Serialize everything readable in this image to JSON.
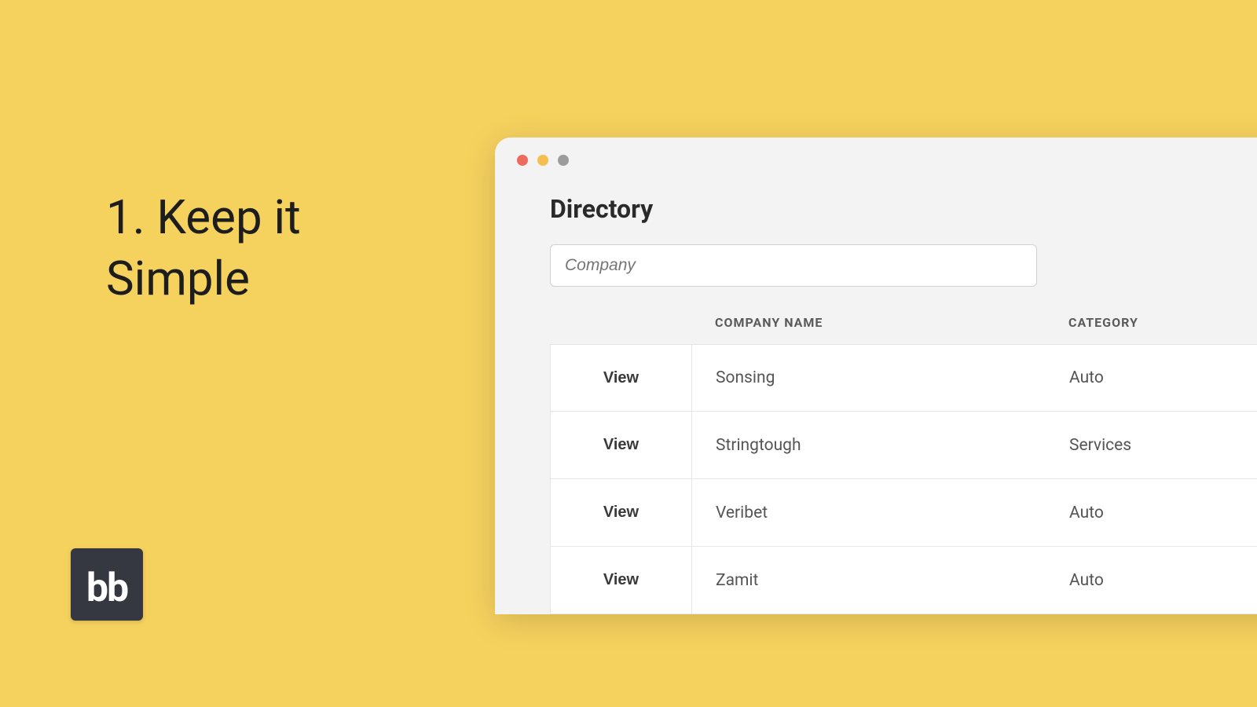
{
  "slide": {
    "title": "1. Keep it Simple"
  },
  "logo": {
    "text": "bb"
  },
  "directory": {
    "heading": "Directory",
    "search_placeholder": "Company",
    "columns": {
      "company": "COMPANY NAME",
      "category": "CATEGORY"
    },
    "view_label": "View",
    "rows": [
      {
        "company": "Sonsing",
        "category": "Auto"
      },
      {
        "company": "Stringtough",
        "category": "Services"
      },
      {
        "company": "Veribet",
        "category": "Auto"
      },
      {
        "company": "Zamit",
        "category": "Auto"
      }
    ]
  }
}
